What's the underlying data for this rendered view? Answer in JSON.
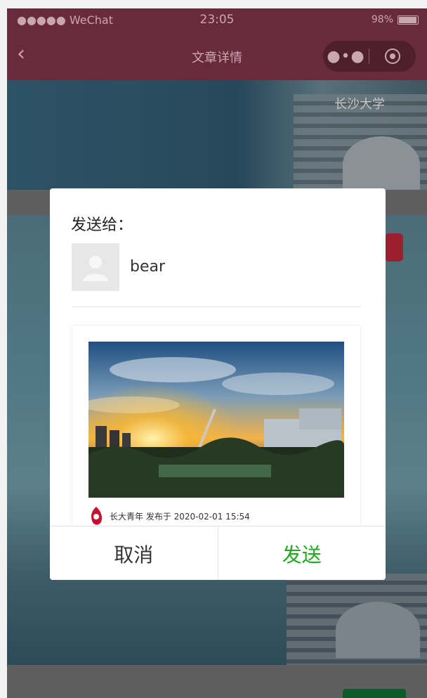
{
  "status_bar": {
    "carrier": "●●●●● WeChat",
    "time": "23:05",
    "battery": "98%"
  },
  "navbar": {
    "title": "文章详情",
    "more_icon": "●•●"
  },
  "background": {
    "banner_sign": "长沙大学"
  },
  "modal": {
    "heading": "发送给：",
    "recipient_name": "bear",
    "card": {
      "meta": "长大青年 发布于 2020-02-01 15:54"
    },
    "cancel_label": "取消",
    "send_label": "发送"
  },
  "colors": {
    "nav": "#6a2a3e",
    "send": "#1aad19"
  }
}
